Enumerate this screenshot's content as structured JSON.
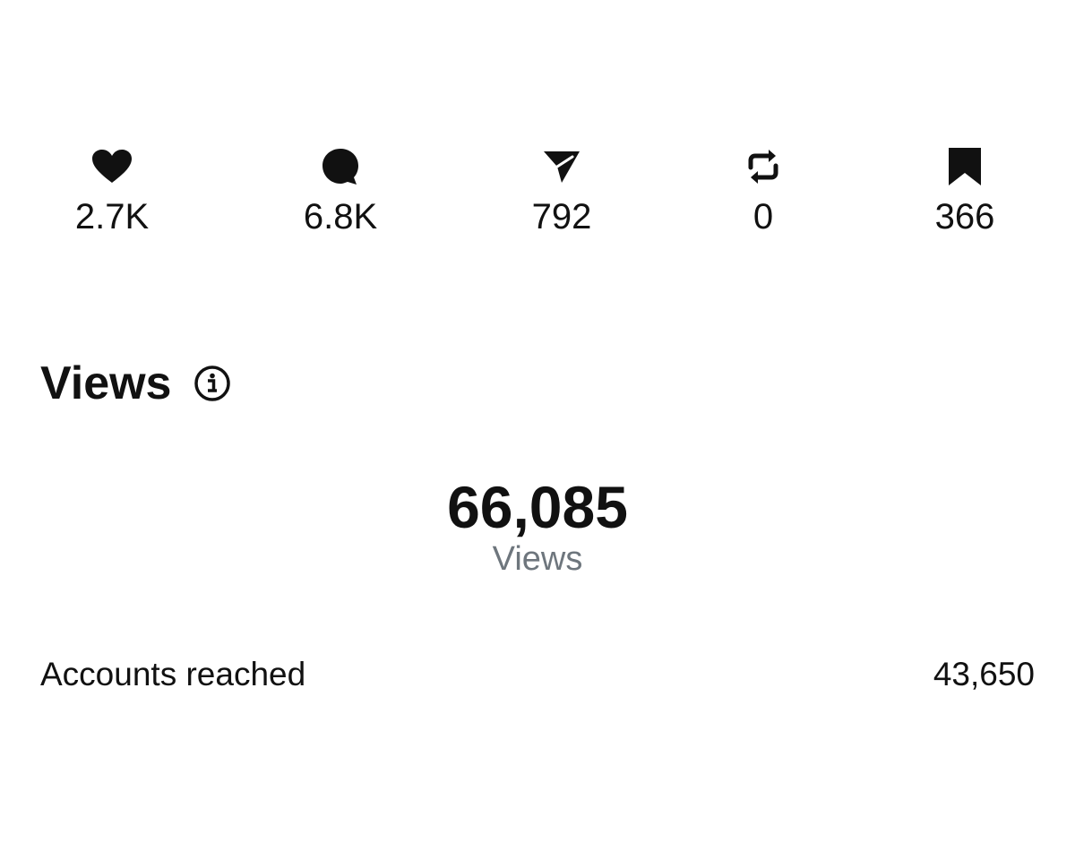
{
  "engagement": {
    "likes": {
      "icon": "heart-icon",
      "value": "2.7K"
    },
    "comments": {
      "icon": "comment-icon",
      "value": "6.8K"
    },
    "shares": {
      "icon": "send-icon",
      "value": "792"
    },
    "reposts": {
      "icon": "repost-icon",
      "value": "0"
    },
    "saves": {
      "icon": "bookmark-icon",
      "value": "366"
    }
  },
  "views_section": {
    "title": "Views",
    "info_icon": "info-icon",
    "total": "66,085",
    "total_caption": "Views"
  },
  "metrics": [
    {
      "label": "Accounts reached",
      "value": "43,650"
    }
  ],
  "colors": {
    "text": "#111111",
    "caption": "#6e767d",
    "background": "#ffffff"
  }
}
